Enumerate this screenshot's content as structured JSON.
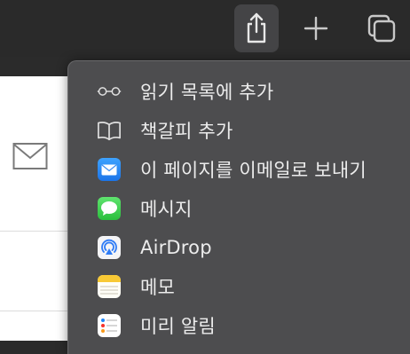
{
  "toolbar": {
    "share_icon": "share-icon",
    "new_tab_icon": "plus-icon",
    "tab_overview_icon": "tabs-icon"
  },
  "share_menu": {
    "items": [
      {
        "label": "읽기 목록에 추가",
        "icon": "reading-glasses-icon"
      },
      {
        "label": "책갈피 추가",
        "icon": "book-icon"
      },
      {
        "label": "이 페이지를 이메일로 보내기",
        "icon": "mail-app-icon"
      },
      {
        "label": "메시지",
        "icon": "messages-app-icon"
      },
      {
        "label": "AirDrop",
        "icon": "airdrop-icon"
      },
      {
        "label": "메모",
        "icon": "notes-app-icon"
      },
      {
        "label": "미리 알림",
        "icon": "reminders-app-icon"
      }
    ]
  },
  "colors": {
    "toolbar_bg": "#2a2a2a",
    "menu_bg": "#4d4d4f",
    "menu_text": "#ececec",
    "page_bg": "#ffffff"
  }
}
